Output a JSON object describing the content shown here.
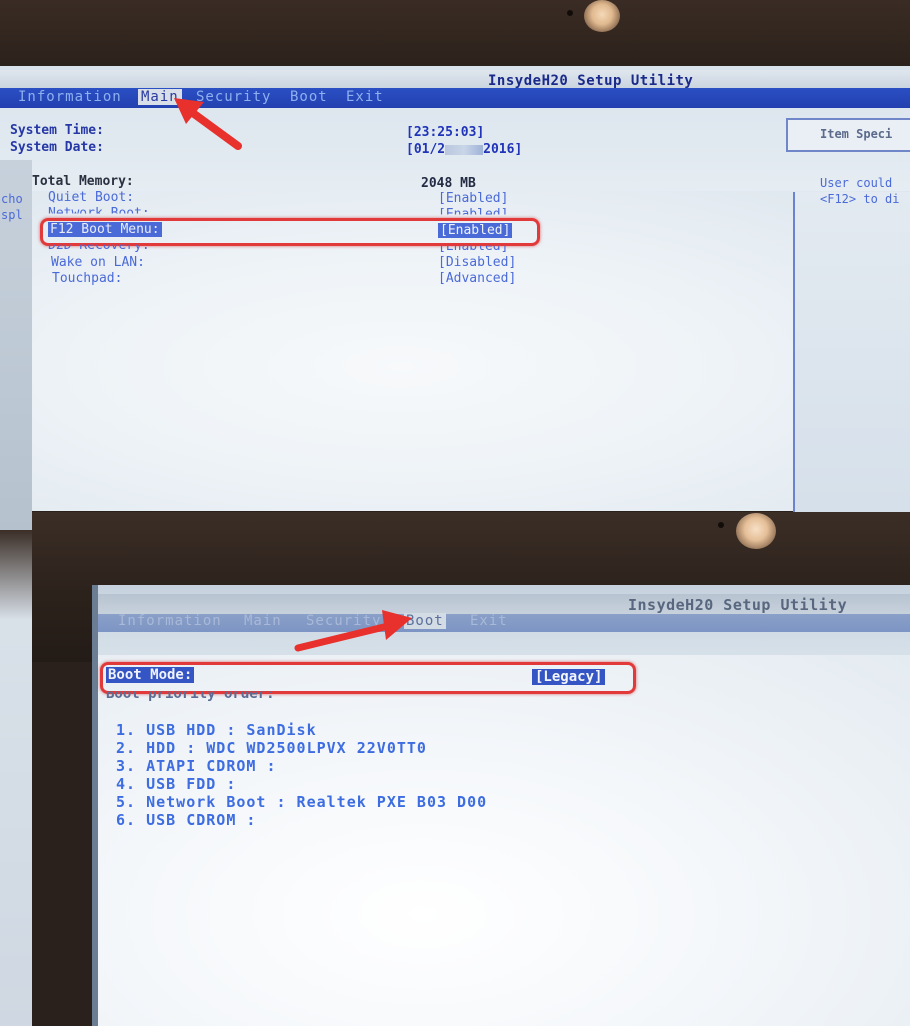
{
  "top": {
    "title": "InsydeH20 Setup Utility",
    "menu": [
      "Information",
      "Main",
      "Security",
      "Boot",
      "Exit"
    ],
    "active_menu": "Main",
    "system_time_label": "System Time:",
    "system_time_value": "[23:25:03]",
    "system_date_label": "System Date:",
    "system_date_value": "[01/2",
    "system_date_value_end": "2016]",
    "total_memory_label": "Total Memory:",
    "total_memory_value": "2048 MB",
    "help_header": "Item Speci",
    "help_line1": "User could",
    "help_line2": "<F12> to di",
    "left_fragment1": "cho",
    "left_fragment2": "spl",
    "settings": [
      {
        "label": "Quiet Boot:",
        "value": "[Enabled]"
      },
      {
        "label": "Network Boot:",
        "value": "[Enabled]"
      },
      {
        "label": "F12 Boot Menu:",
        "value": "[Enabled]"
      },
      {
        "label": "D2D Recovery:",
        "value": "[Enabled]"
      },
      {
        "label": "Wake on LAN:",
        "value": "[Disabled]"
      },
      {
        "label": "Touchpad:",
        "value": "[Advanced]"
      }
    ]
  },
  "bottom": {
    "title": "InsydeH20 Setup Utility",
    "menu": [
      "Information",
      "Main",
      "Security",
      "Boot",
      "Exit"
    ],
    "active_menu": "Boot",
    "boot_mode_label": "Boot Mode:",
    "boot_mode_value": "[Legacy]",
    "boot_priority_label": "Boot priority order:",
    "boot_order": [
      "1. USB HDD : SanDisk",
      "2. HDD : WDC WD2500LPVX 22V0TT0",
      "3. ATAPI CDROM :",
      "4. USB FDD :",
      "5. Network Boot : Realtek PXE B03 D00",
      "6. USB CDROM :"
    ]
  },
  "colors": {
    "highlight": "#e23a3a",
    "arrow": "#e8302c",
    "menu_bar": "#2a4fc4"
  }
}
